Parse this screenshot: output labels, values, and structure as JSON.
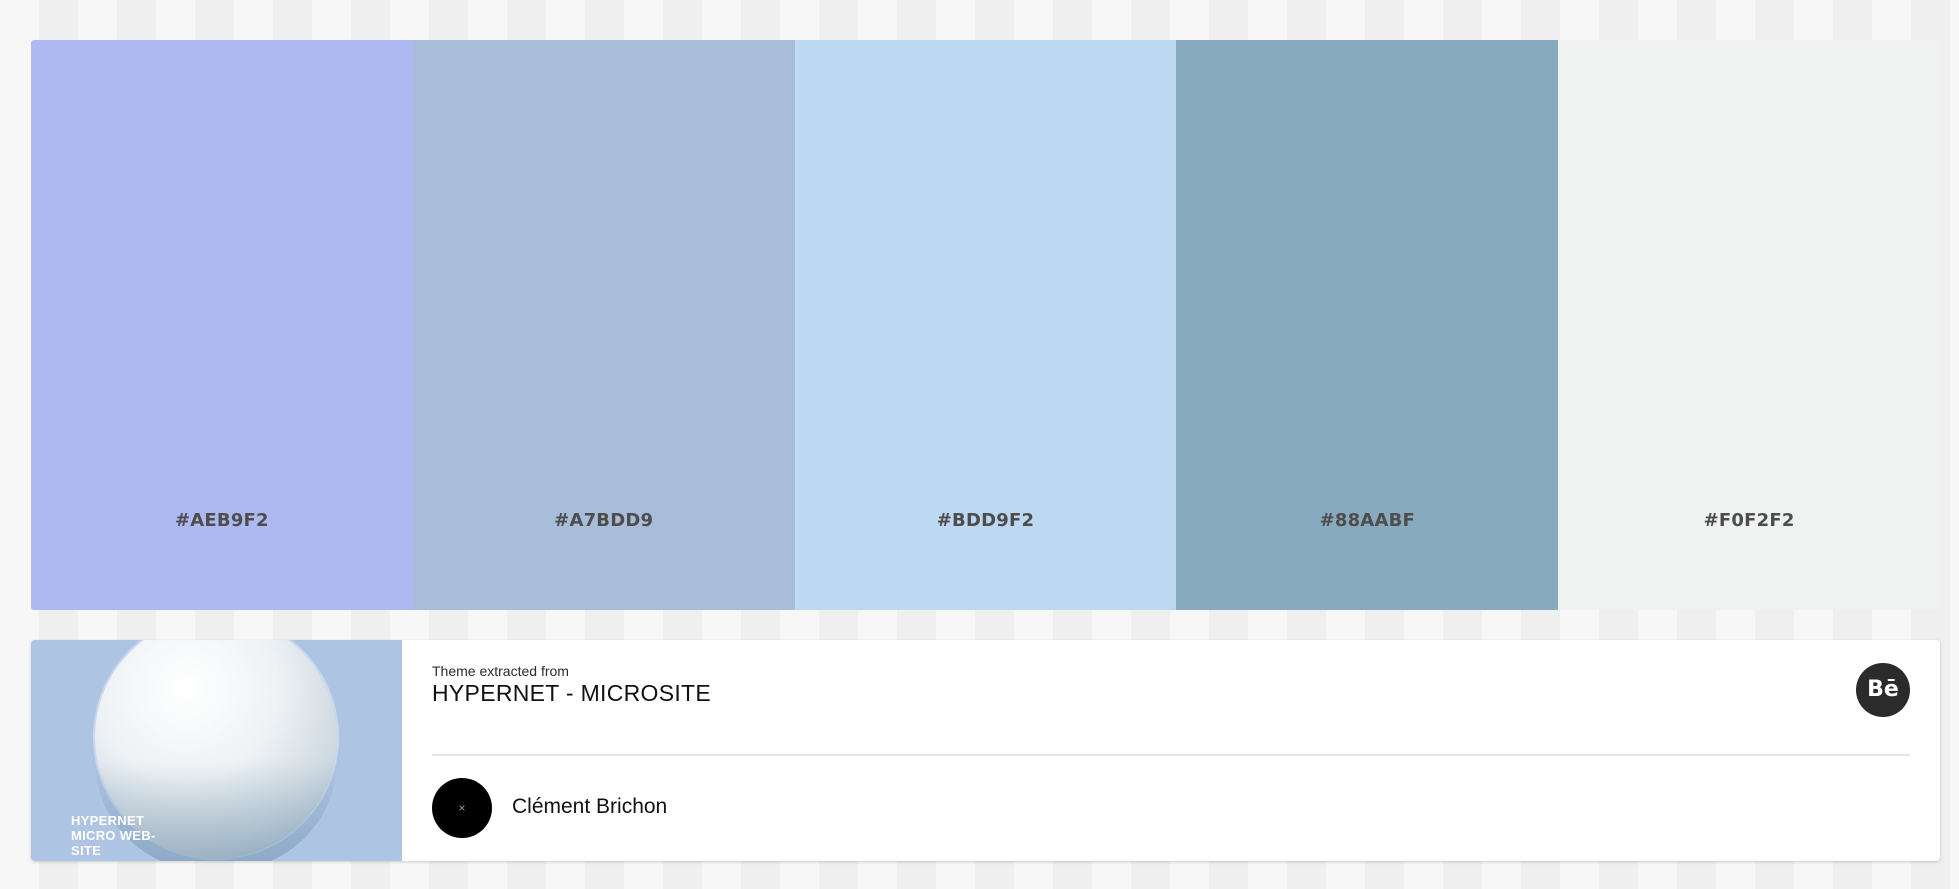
{
  "palette": {
    "swatches": [
      {
        "hex_label": "#AEB9F2",
        "color": "#AEB9F2"
      },
      {
        "hex_label": "#A7BDD9",
        "color": "#A7BDD9"
      },
      {
        "hex_label": "#BDD9F2",
        "color": "#BDD9F2"
      },
      {
        "hex_label": "#88AABF",
        "color": "#88AABF"
      },
      {
        "hex_label": "#F0F2F2",
        "color": "#F0F2F2"
      }
    ]
  },
  "source": {
    "caption": "Theme extracted from",
    "title": "HYPERNET - MICROSITE",
    "thumbnail_text": "HYPERNET MICRO WEB-SITE",
    "behance_label": "Bē",
    "behance_icon": "behance-icon"
  },
  "author": {
    "name": "Clément Brichon",
    "avatar_glyph": "×"
  }
}
